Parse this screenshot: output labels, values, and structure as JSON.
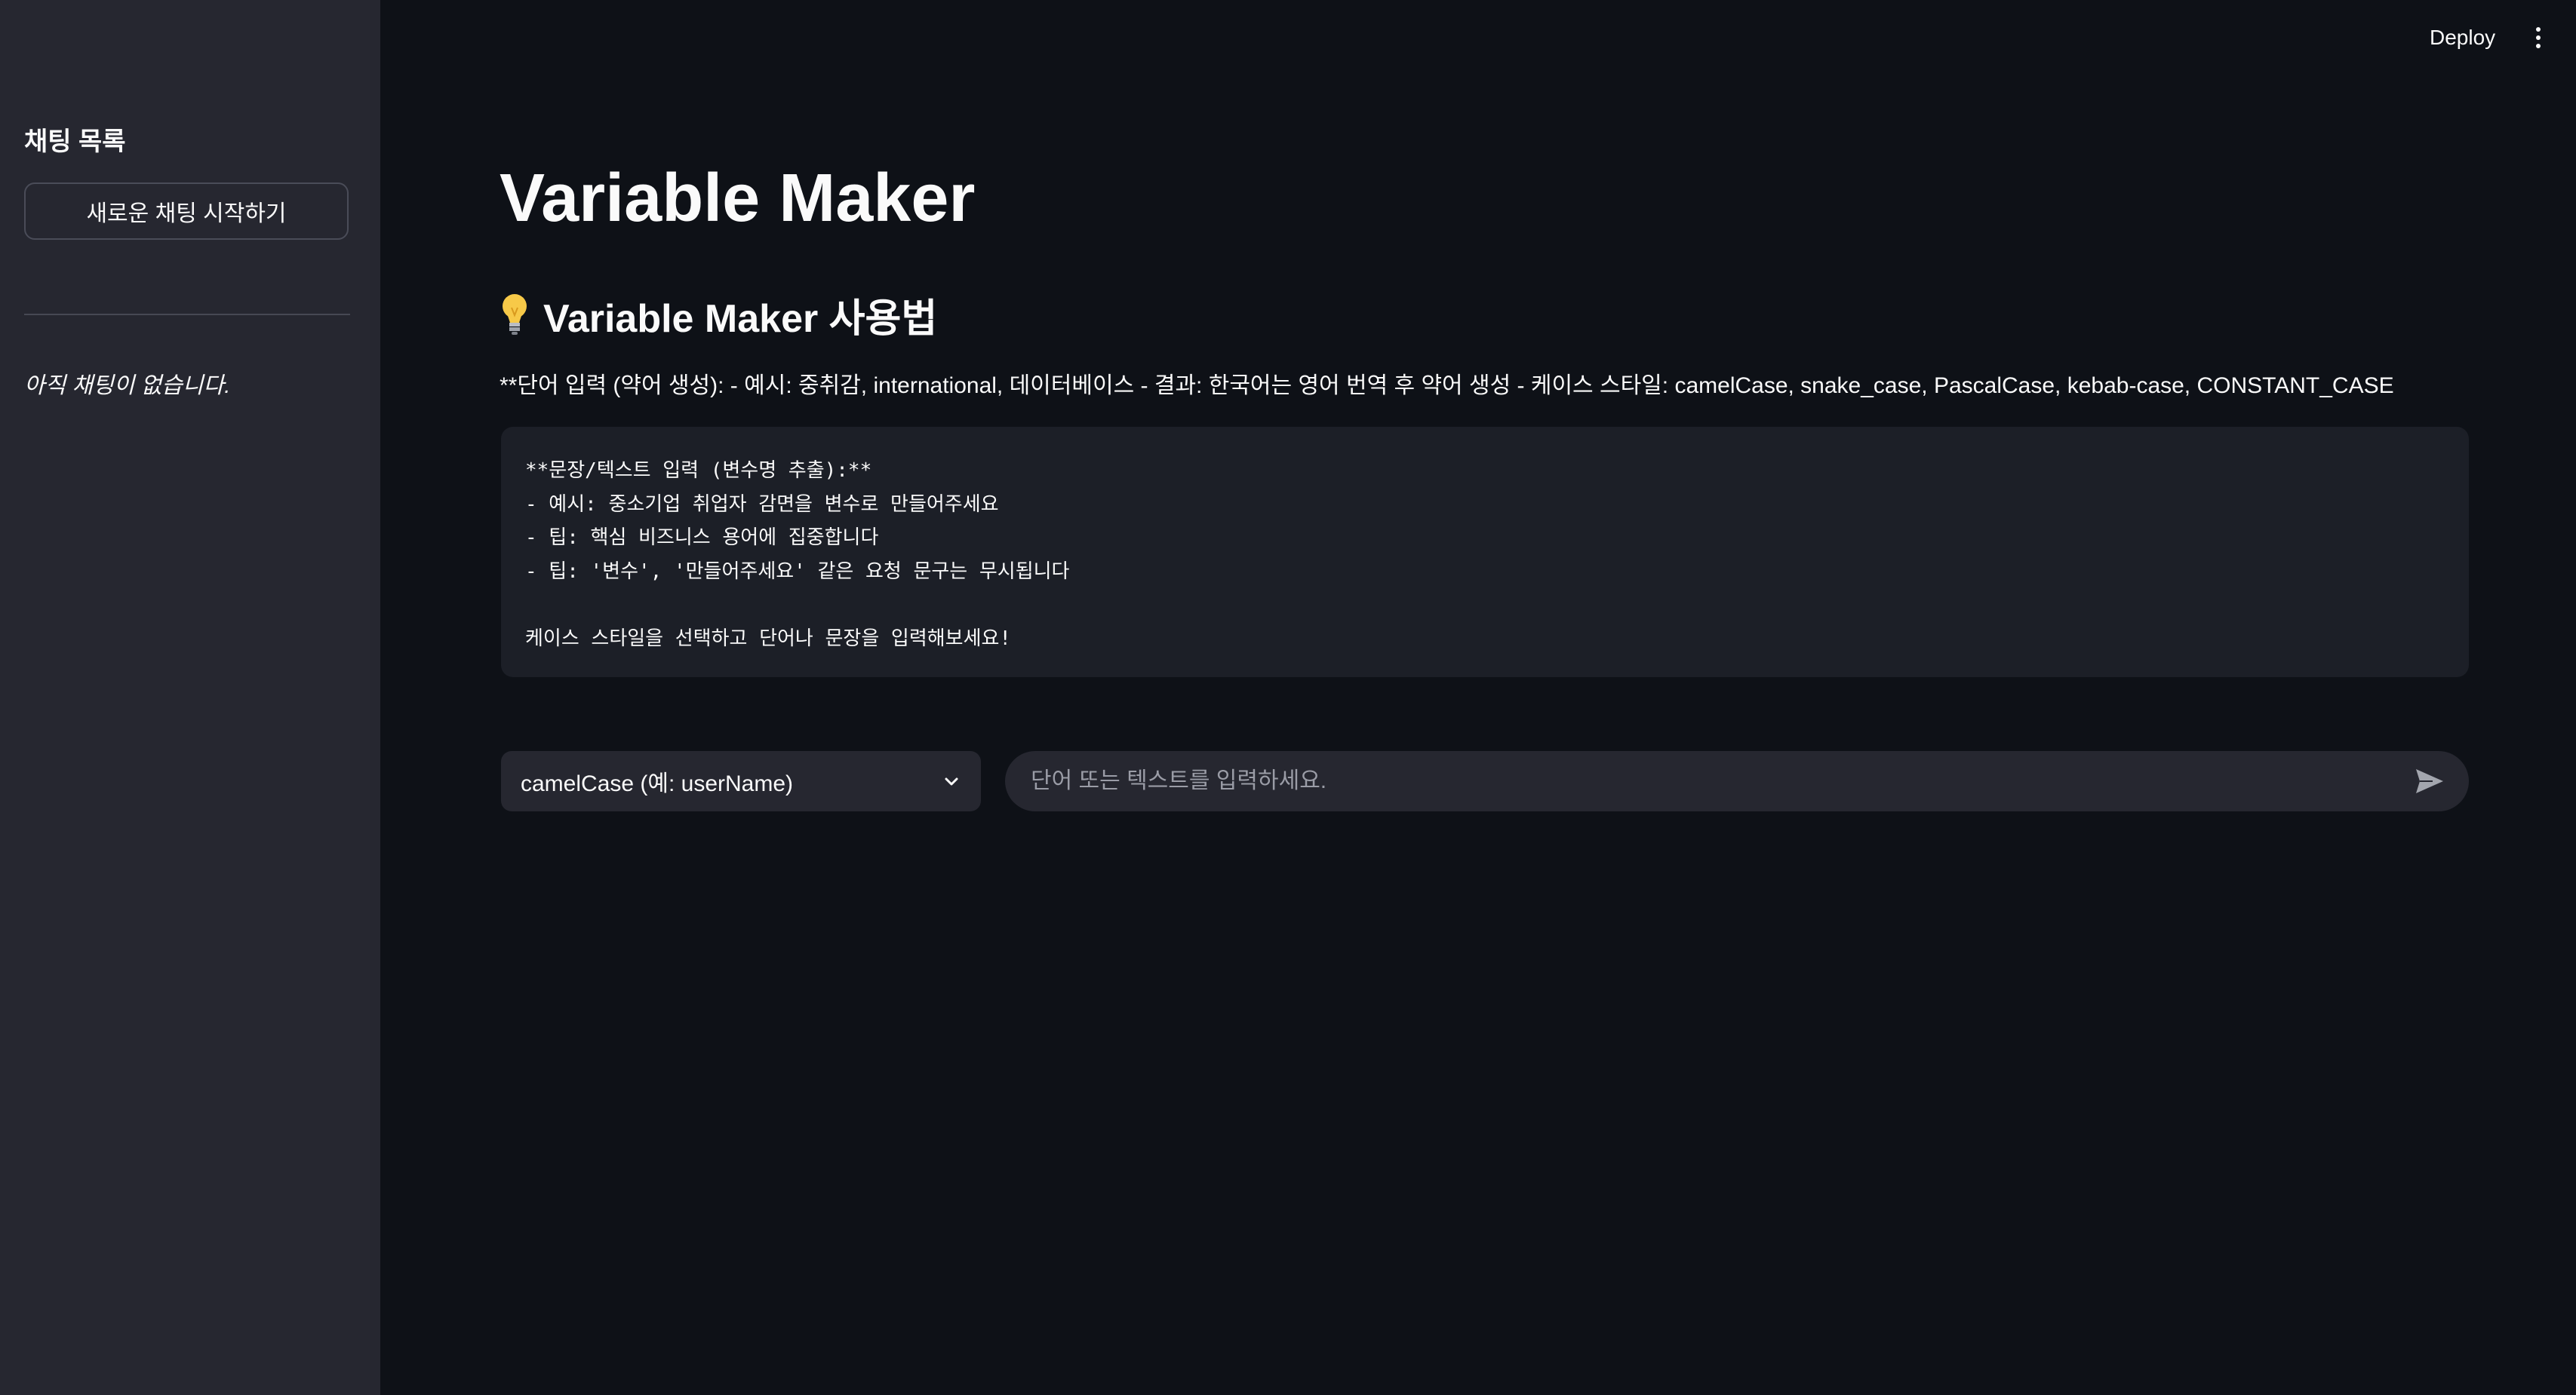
{
  "header": {
    "deploy_label": "Deploy",
    "menu_icon": "kebab-menu-icon"
  },
  "sidebar": {
    "title": "채팅 목록",
    "new_chat_label": "새로운 채팅 시작하기",
    "empty_text": "아직 채팅이 없습니다."
  },
  "main": {
    "title": "Variable Maker",
    "subheader_icon": "lightbulb-icon",
    "subheader": "Variable Maker 사용법",
    "description": "**단어 입력 (약어 생성): - 예시: 중취감, international, 데이터베이스 - 결과: 한국어는 영어 번역 후 약어 생성 - 케이스 스타일: camelCase, snake_case, PascalCase, kebab-case, CONSTANT_CASE",
    "code_lines": [
      "**문장/텍스트 입력 (변수명 추출):**",
      "- 예시: 중소기업 취업자 감면을 변수로 만들어주세요",
      "- 팁: 핵심 비즈니스 용어에 집중합니다",
      "- 팁: '변수', '만들어주세요' 같은 요청 문구는 무시됩니다",
      "",
      "케이스 스타일을 선택하고 단어나 문장을 입력해보세요!"
    ],
    "case_select": {
      "value": "camelCase (예: userName)"
    },
    "chat_input": {
      "placeholder": "단어 또는 텍스트를 입력하세요.",
      "value": ""
    }
  },
  "colors": {
    "background": "#0e1117",
    "sidebar": "#262730",
    "code_block": "#1c1f27",
    "input": "#262730",
    "text": "#fafafa"
  }
}
